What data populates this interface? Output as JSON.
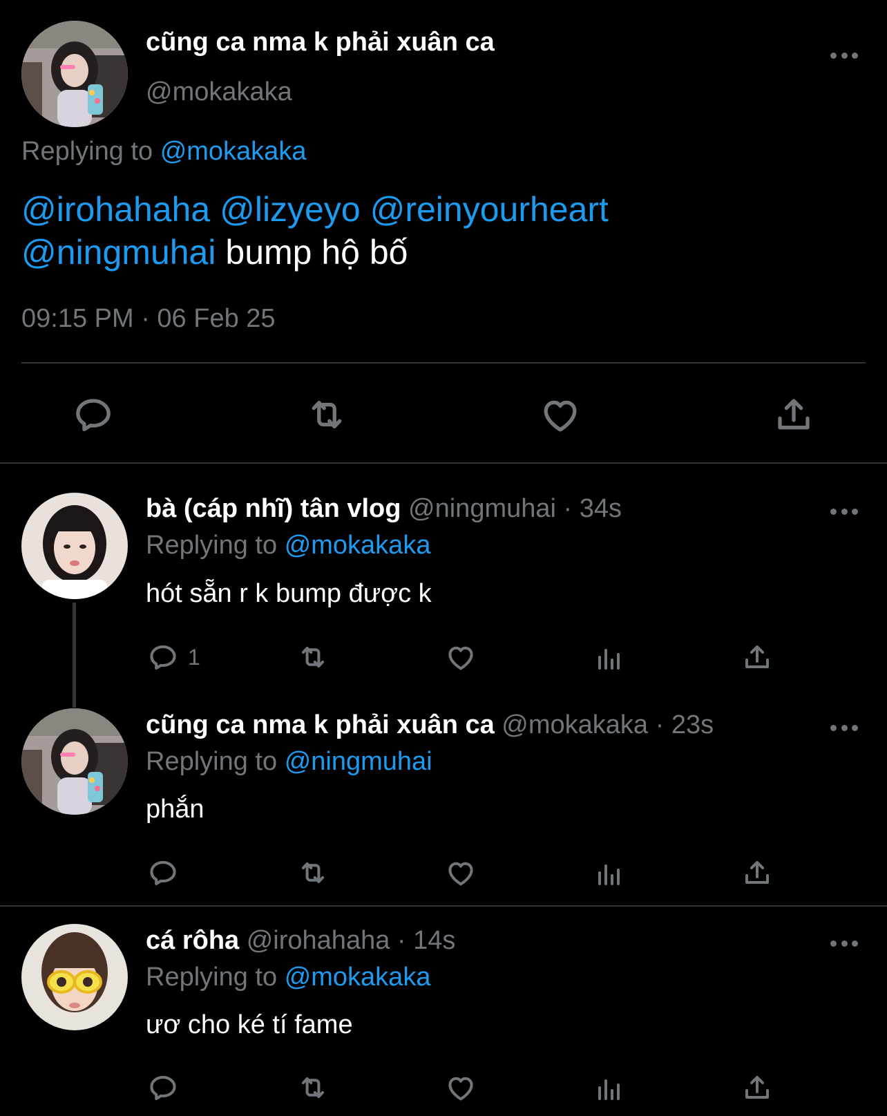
{
  "main_tweet": {
    "display_name": "cũng ca nma k phải xuân ca",
    "handle": "@mokakaka",
    "replying_label": "Replying to",
    "replying_to": "@mokakaka",
    "mentions": [
      "@irohahaha",
      "@lizyeyo",
      "@reinyourheart",
      "@ningmuhai"
    ],
    "text": "bump hộ bố",
    "timestamp": "09:15 PM · 06 Feb 25",
    "actions": [
      "reply-icon",
      "retweet-icon",
      "like-icon",
      "share-icon"
    ]
  },
  "replies": [
    {
      "display_name": "bà (cáp nhĩ) tân vlog",
      "handle": "@ningmuhai",
      "time": "· 34s",
      "replying_label": "Replying to",
      "replying_to": "@mokakaka",
      "text": "hót sẵn r k bump được k",
      "reply_count": "1"
    },
    {
      "display_name": "cũng ca nma k phải xuân ca",
      "handle": "@mokakaka",
      "time": "· 23s",
      "replying_label": "Replying to",
      "replying_to": "@ningmuhai",
      "text": "phắn",
      "reply_count": ""
    },
    {
      "display_name": "cá rôha",
      "handle": "@irohahaha",
      "time": "· 14s",
      "replying_label": "Replying to",
      "replying_to": "@mokakaka",
      "text": "ươ cho ké tí fame",
      "reply_count": ""
    }
  ],
  "colors": {
    "background": "#000000",
    "text": "#ffffff",
    "secondary": "#71767b",
    "link": "#1d9bf0",
    "divider": "#2f3336"
  }
}
